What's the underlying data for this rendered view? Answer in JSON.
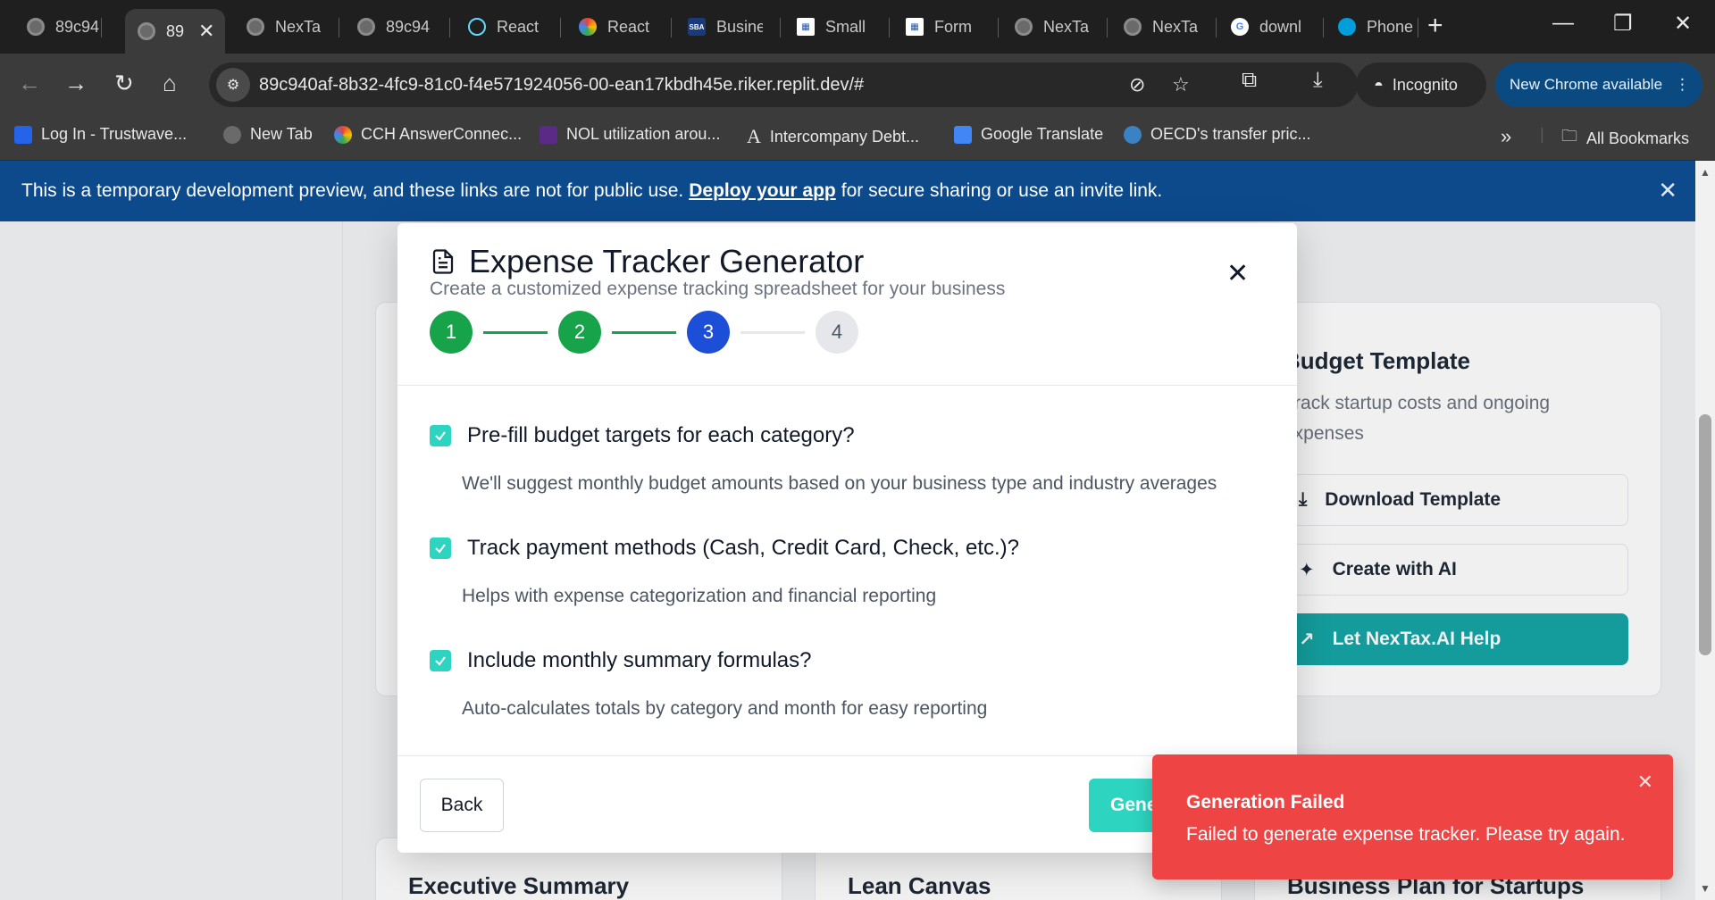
{
  "browser": {
    "tabs": [
      {
        "title": "89c94",
        "icon": "globe-icon"
      },
      {
        "title": "89",
        "icon": "globe-icon",
        "active": true
      },
      {
        "title": "NexTa",
        "icon": "globe-icon"
      },
      {
        "title": "89c94",
        "icon": "globe-icon"
      },
      {
        "title": "React",
        "icon": "react-icon"
      },
      {
        "title": "React",
        "icon": "rainbow-icon"
      },
      {
        "title": "Busine",
        "icon": "sba-icon"
      },
      {
        "title": "Small",
        "icon": "form-icon"
      },
      {
        "title": "Form",
        "icon": "form-icon"
      },
      {
        "title": "NexTa",
        "icon": "globe-icon"
      },
      {
        "title": "NexTa",
        "icon": "globe-icon"
      },
      {
        "title": "downl",
        "icon": "google-icon"
      },
      {
        "title": "Phone",
        "icon": "att-icon"
      }
    ],
    "url": "89c940af-8b32-4fc9-81c0-f4e571924056-00-ean17kbdh45e.riker.replit.dev/#",
    "incognito_label": "Incognito",
    "new_chrome_label": "New Chrome available",
    "bookmarks": [
      {
        "label": "Log In - Trustwave...",
        "color": "#2563eb"
      },
      {
        "label": "New Tab",
        "color": "#6a6a6a"
      },
      {
        "label": "CCH AnswerConnec...",
        "color": "#e94235"
      },
      {
        "label": "NOL utilization arou...",
        "color": "#5b2a86"
      },
      {
        "label": "Intercompany Debt...",
        "color": "#ffffff"
      },
      {
        "label": "Google Translate",
        "color": "#4285f4"
      },
      {
        "label": "OECD's transfer pric...",
        "color": "#3b82c4"
      }
    ],
    "all_bookmarks_label": "All Bookmarks"
  },
  "banner": {
    "text_before": "This is a temporary development preview, and these links are not for public use.",
    "link": "Deploy your app",
    "text_after": "for secure sharing or use an invite link."
  },
  "background": {
    "budget_card": {
      "title": "Budget Template",
      "desc_line1": "Track startup costs and ongoing",
      "desc_line2": "expenses",
      "download_label": "Download Template",
      "ai_label": "Create with AI",
      "help_label": "Let NexTax.AI Help"
    },
    "bottom_cards": [
      "Executive Summary",
      "Lean Canvas",
      "Business Plan for Startups"
    ]
  },
  "modal": {
    "title": "Expense Tracker Generator",
    "subtitle": "Create a customized expense tracking spreadsheet for your business",
    "steps": [
      "1",
      "2",
      "3",
      "4"
    ],
    "current_step": 3,
    "options": [
      {
        "label": "Pre-fill budget targets for each category?",
        "help": "We'll suggest monthly budget amounts based on your business type and industry averages",
        "checked": true
      },
      {
        "label": "Track payment methods (Cash, Credit Card, Check, etc.)?",
        "help": "Helps with expense categorization and financial reporting",
        "checked": true
      },
      {
        "label": "Include monthly summary formulas?",
        "help": "Auto-calculates totals by category and month for easy reporting",
        "checked": true
      }
    ],
    "back_label": "Back",
    "generate_label": "Gene"
  },
  "toast": {
    "title": "Generation Failed",
    "message": "Failed to generate expense tracker. Please try again."
  },
  "colors": {
    "banner": "#0d4a8c",
    "step_done": "#16a34a",
    "step_current": "#1d4ed8",
    "checkbox": "#2dd4bf",
    "toast": "#ef4444",
    "teal_button": "#16a5a5"
  }
}
